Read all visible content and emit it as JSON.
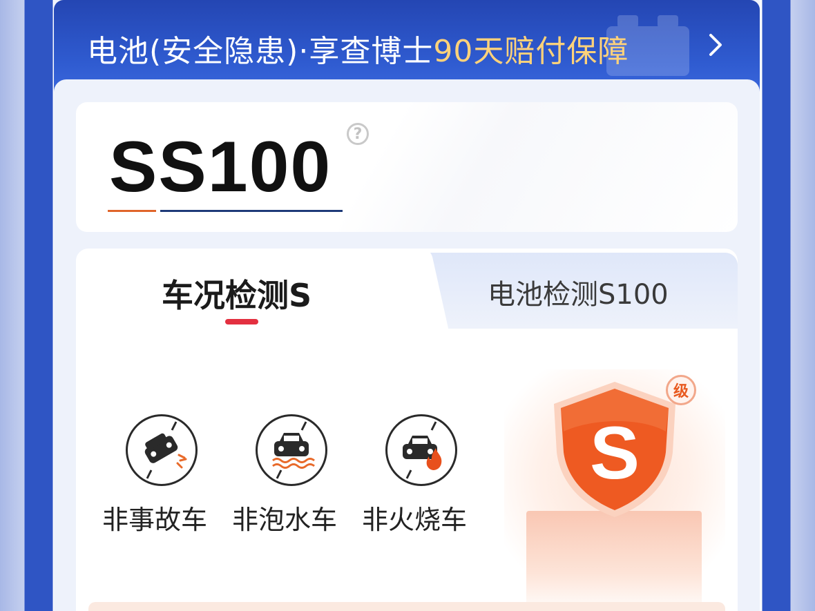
{
  "banner": {
    "text_main": "电池(安全隐患)·享查博士",
    "text_highlight": "90天赔付保障",
    "chevron_icon": "chevron-right-icon",
    "highlight_color": "#ffd27a"
  },
  "score": {
    "grade": "SS100",
    "help_icon": "question-icon",
    "help_symbol": "?"
  },
  "tabs": [
    {
      "label": "车况检测S",
      "active": true
    },
    {
      "label": "电池检测S100",
      "active": false
    }
  ],
  "checks": [
    {
      "label": "非事故车",
      "icon": "accident-car-icon"
    },
    {
      "label": "非泡水车",
      "icon": "flooded-car-icon"
    },
    {
      "label": "非火烧车",
      "icon": "burned-car-icon"
    }
  ],
  "badge": {
    "letter": "S",
    "tag": "级",
    "color": "#ee5a22"
  }
}
